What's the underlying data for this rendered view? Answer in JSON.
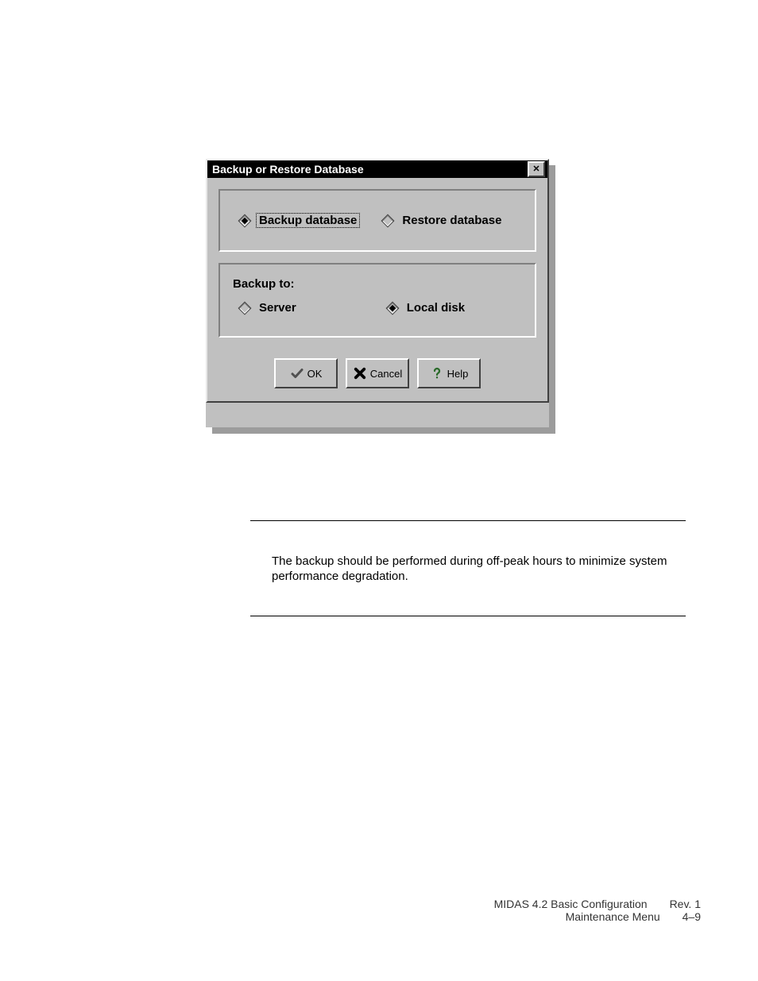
{
  "dialog": {
    "title": "Backup or Restore Database",
    "operation": {
      "backup_label": "Backup database",
      "restore_label": "Restore database",
      "selected": "backup"
    },
    "destination": {
      "group_label": "Backup to:",
      "server_label": "Server",
      "local_label": "Local disk",
      "selected": "local"
    },
    "buttons": {
      "ok": "OK",
      "cancel": "Cancel",
      "help": "Help"
    }
  },
  "note": {
    "text": "The backup should be performed during off-peak hours to minimize system performance degradation."
  },
  "footer": {
    "doc_title": "MIDAS 4.2 Basic Configuration",
    "section": "Maintenance Menu",
    "revision": "Rev. 1",
    "page": "4–9"
  }
}
